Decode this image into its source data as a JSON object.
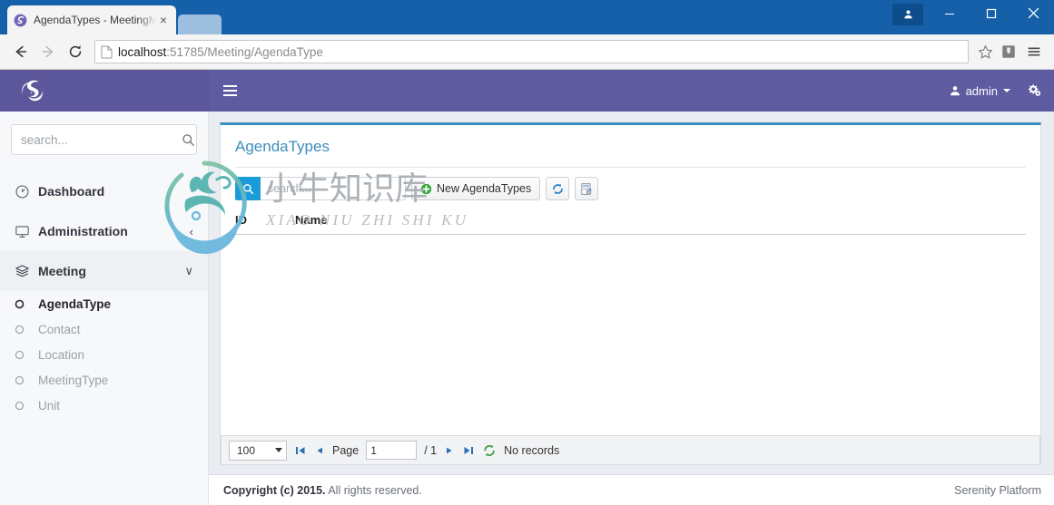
{
  "browser": {
    "tab": {
      "title": "AgendaTypes - MeetingM",
      "favicon": "serenity-spiral-icon",
      "close": "×"
    },
    "nav": {
      "back": "back-arrow-icon",
      "forward": "forward-arrow-icon",
      "reload": "reload-icon"
    },
    "url": {
      "host": "localhost",
      "rest": ":51785/Meeting/AgendaType"
    },
    "window": {
      "profile": "profile-icon",
      "minimize": "–",
      "maximize": "□",
      "close": "✕"
    }
  },
  "navbar": {
    "brand_logo": "serenity-spiral-logo",
    "toggle": "hamburger-icon",
    "user": "admin",
    "settings_icon": "gear-cogs-icon"
  },
  "sidebar": {
    "search_placeholder": "search...",
    "search_value": "",
    "items": [
      {
        "label": "Dashboard",
        "icon": "dashboard-gauge-icon",
        "chevron": ""
      },
      {
        "label": "Administration",
        "icon": "monitor-icon",
        "chevron": "‹"
      },
      {
        "label": "Meeting",
        "icon": "layers-icon",
        "chevron": "∨"
      }
    ],
    "sub_items": [
      {
        "label": "AgendaType",
        "active": true
      },
      {
        "label": "Contact",
        "active": false
      },
      {
        "label": "Location",
        "active": false
      },
      {
        "label": "MeetingType",
        "active": false
      },
      {
        "label": "Unit",
        "active": false
      }
    ]
  },
  "panel": {
    "title": "AgendaTypes",
    "accent_color": "#3c8dbc",
    "toolbar": {
      "quick_search_placeholder": "search...",
      "quick_search_value": "",
      "search_icon": "magnifier-icon",
      "new_button": "New AgendaTypes",
      "new_icon": "green-plus-icon",
      "refresh_icon": "refresh-sync-icon",
      "export_icon": "export-xml-icon"
    },
    "grid": {
      "columns": [
        "ID",
        "Name"
      ],
      "rows": []
    },
    "pager": {
      "page_size": "100",
      "first_icon": "first-page-icon",
      "prev_icon": "prev-page-icon",
      "page_label": "Page",
      "page_value": "1",
      "page_total": "/ 1",
      "next_icon": "next-page-icon",
      "last_icon": "last-page-icon",
      "refresh_icon": "pager-refresh-icon",
      "status": "No records"
    }
  },
  "footer": {
    "copyright_bold": "Copyright (c) 2015.",
    "copyright_rest": "All rights reserved.",
    "platform": "Serenity Platform"
  },
  "watermark": {
    "chinese": "小牛知识库",
    "pinyin": "XIAO NIU ZHI SHI KU"
  }
}
